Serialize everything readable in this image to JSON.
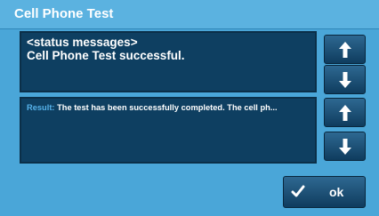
{
  "title": "Cell Phone Test",
  "status_panel": {
    "lines": [
      "<status messages>",
      "Cell Phone Test successful."
    ]
  },
  "result_panel": {
    "prefix": "Result:",
    "text": " The test has been successfully completed. The cell ph..."
  },
  "buttons": {
    "ok_label": "ok"
  },
  "icons": {
    "up": "arrow-up-icon",
    "down": "arrow-down-icon",
    "check": "checkmark-icon"
  },
  "colors": {
    "background": "#4aa6d8",
    "panel": "#0e3f61",
    "result_prefix": "#56b2ea"
  }
}
